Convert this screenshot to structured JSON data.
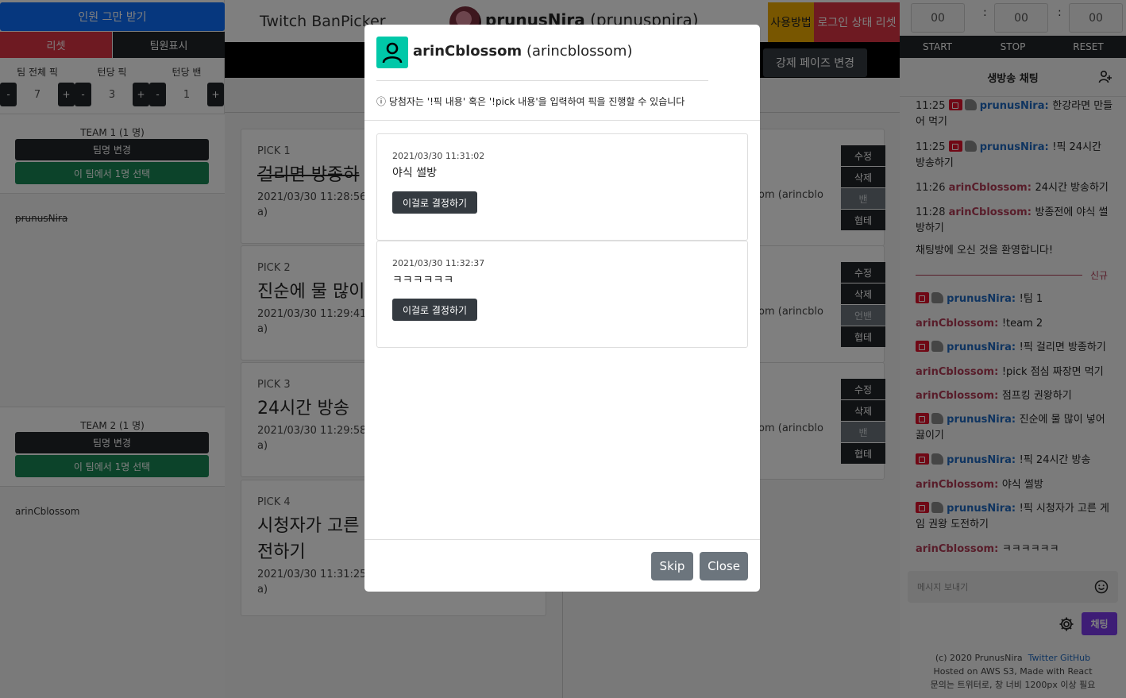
{
  "left": {
    "stop_recruit": "인원 그만 받기",
    "reset": "리셋",
    "show_members": "팀원표시",
    "steppers": [
      {
        "label": "팀 전체 픽",
        "value": "7"
      },
      {
        "label": "턴당 픽",
        "value": "3"
      },
      {
        "label": "턴당 밴",
        "value": "1"
      }
    ],
    "minus": "-",
    "plus": "+",
    "teams": [
      {
        "title": "TEAM 1 (1 명)",
        "rename": "팀명 변경",
        "pick_one": "이 팀에서 1명 선택",
        "member": "prunusNira"
      },
      {
        "title": "TEAM 2 (1 명)",
        "rename": "팀명 변경",
        "pick_one": "이 팀에서 1명 선택",
        "member": "arinCblossom"
      }
    ]
  },
  "header": {
    "app_title": "Twitch BanPicker",
    "streamer_display": "prunusNira",
    "streamer_login": "(prunuspnira)",
    "howto": "사용방법",
    "login_reset": "로그인 상태 리셋",
    "force_phase": "강제 페이즈 변경"
  },
  "center": {
    "picks": [
      {
        "label": "PICK 1",
        "text": "걸리면 방종하",
        "meta": "2021/03/30 11:28:56 b",
        "meta2": "a)"
      },
      {
        "label": "PICK 2",
        "text": "진순에 물 많이",
        "meta": "2021/03/30 11:29:41 b",
        "meta2": "a)"
      },
      {
        "label": "PICK 3",
        "text": "24시간 방송",
        "meta": "2021/03/30 11:29:58 b",
        "meta2": "a)"
      },
      {
        "label": "PICK 4",
        "text": "시청자가 고른",
        "text2": "전하기",
        "meta": "2021/03/30 11:31:25 b",
        "meta2": "a)"
      }
    ],
    "right_cards": [
      {
        "meta": "om (arincblo",
        "edit": "수정",
        "delete": "삭제",
        "status": "밴"
      },
      {
        "meta": "om (arincblo",
        "edit": "수정",
        "delete": "삭제",
        "status": "언밴"
      },
      {
        "meta": "om (arincblo",
        "edit": "수정",
        "delete": "삭제",
        "status": "밴"
      }
    ],
    "team_label": "협테"
  },
  "modal": {
    "winner_display": "arinCblossom",
    "winner_login": "(arincblossom)",
    "info": "ⓘ 당첨자는 '!픽 내용' 혹은 '!pick 내용'을 입력하여 픽을 진행할 수 있습니다",
    "candidates": [
      {
        "time": "2021/03/30 11:31:02",
        "text": "야식 썰방",
        "button": "이걸로 결정하기"
      },
      {
        "time": "2021/03/30 11:32:37",
        "text": "ㅋㅋㅋㅋㅋㅋ",
        "button": "이걸로 결정하기"
      }
    ],
    "skip": "Skip",
    "close": "Close"
  },
  "right": {
    "timer": [
      "00",
      "00",
      "00"
    ],
    "start": "START",
    "stop": "STOP",
    "reset": "RESET",
    "chat_title": "생방송 채팅",
    "new_label": "신규",
    "input_placeholder": "메시지 보내기",
    "send": "채팅",
    "footer": {
      "copyright": "(c) 2020 PrunusNira",
      "twitter": "Twitter",
      "github": "GitHub",
      "hosted": "Hosted on AWS S3, Made with React",
      "contact": "문의는 트위터로, 창 너비 1200px 이상 필요"
    },
    "messages": [
      {
        "time": "11:25",
        "user": "prunusNira",
        "text": "한강라면 만들어 먹기"
      },
      {
        "time": "11:25",
        "user": "prunusNira",
        "text": "!픽 24시간 방송하기"
      },
      {
        "time": "11:26",
        "user": "arinCblossom",
        "text": "24시간 방송하기"
      },
      {
        "time": "11:28",
        "user": "arinCblossom",
        "text": "방종전에 야식 썰방하기"
      },
      {
        "text": "채팅방에 오신 것을 환영합니다!"
      },
      {
        "user": "prunusNira",
        "text": "!팀 1"
      },
      {
        "user": "arinCblossom",
        "text": "!team 2"
      },
      {
        "user": "prunusNira",
        "text": "!픽 걸리면 방종하기"
      },
      {
        "user": "arinCblossom",
        "text": "!pick 점심 짜장면 먹기"
      },
      {
        "user": "arinCblossom",
        "text": "점프킹 권왕하기"
      },
      {
        "user": "prunusNira",
        "text": "진순에 물 많이 넣어 끓이기"
      },
      {
        "user": "prunusNira",
        "text": "!픽 24시간 방송"
      },
      {
        "user": "arinCblossom",
        "text": "야식 썰방"
      },
      {
        "user": "prunusNira",
        "text": "!픽 시청자가 고른 게임 권왕 도전하기"
      },
      {
        "user": "arinCblossom",
        "text": "ㅋㅋㅋㅋㅋㅋ"
      }
    ]
  }
}
